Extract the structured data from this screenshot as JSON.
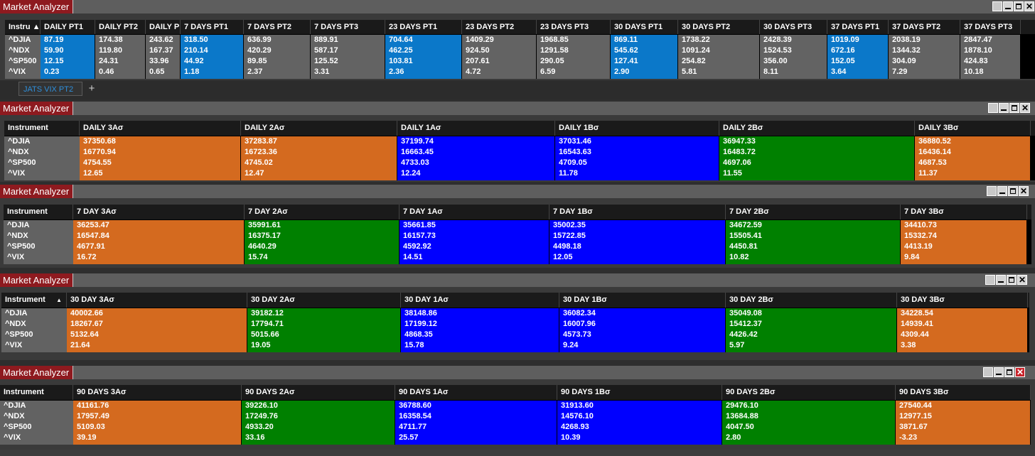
{
  "instruments": [
    "^DJIA",
    "^NDX",
    "^SP500",
    "^VIX"
  ],
  "panel1": {
    "title": "Market Analyzer",
    "label_header": "Instru ▲",
    "columns": [
      {
        "h": "DAILY PT1",
        "v": [
          "87.19",
          "59.90",
          "12.15",
          "0.23"
        ]
      },
      {
        "h": "DAILY PT2",
        "v": [
          "174.38",
          "119.80",
          "24.31",
          "0.46"
        ]
      },
      {
        "h": "DAILY P",
        "v": [
          "243.62",
          "167.37",
          "33.96",
          "0.65"
        ]
      },
      {
        "h": "7 DAYS PT1",
        "v": [
          "318.50",
          "210.14",
          "44.92",
          "1.18"
        ]
      },
      {
        "h": "7 DAYS PT2",
        "v": [
          "636.99",
          "420.29",
          "89.85",
          "2.37"
        ]
      },
      {
        "h": "7 DAYS PT3",
        "v": [
          "889.91",
          "587.17",
          "125.52",
          "3.31"
        ]
      },
      {
        "h": "23 DAYS PT1",
        "v": [
          "704.64",
          "462.25",
          "103.81",
          "2.36"
        ]
      },
      {
        "h": "23 DAYS PT2",
        "v": [
          "1409.29",
          "924.50",
          "207.61",
          "4.72"
        ]
      },
      {
        "h": "23 DAYS PT3",
        "v": [
          "1968.85",
          "1291.58",
          "290.05",
          "6.59"
        ]
      },
      {
        "h": "30 DAYS PT1",
        "v": [
          "869.11",
          "545.62",
          "127.41",
          "2.90"
        ]
      },
      {
        "h": "30 DAYS PT2",
        "v": [
          "1738.22",
          "1091.24",
          "254.82",
          "5.81"
        ]
      },
      {
        "h": "30 DAYS PT3",
        "v": [
          "2428.39",
          "1524.53",
          "356.00",
          "8.11"
        ]
      },
      {
        "h": "37 DAYS PT1",
        "v": [
          "1019.09",
          "672.16",
          "152.05",
          "3.64"
        ]
      },
      {
        "h": "37 DAYS PT2",
        "v": [
          "2038.19",
          "1344.32",
          "304.09",
          "7.29"
        ]
      },
      {
        "h": "37 DAYS PT3",
        "v": [
          "2847.47",
          "1878.10",
          "424.83",
          "10.18"
        ]
      }
    ],
    "tab": "JATS VIX PT2",
    "add_tab": "+"
  },
  "panel2": {
    "title": "Market Analyzer",
    "label_header": "Instrument",
    "columns": [
      {
        "h": "DAILY 3Aσ",
        "v": [
          "37350.68",
          "16770.94",
          "4754.55",
          "12.65"
        ]
      },
      {
        "h": "DAILY 2Aσ",
        "v": [
          "37283.87",
          "16723.36",
          "4745.02",
          "12.47"
        ]
      },
      {
        "h": "DAILY 1Aσ",
        "v": [
          "37199.74",
          "16663.45",
          "4733.03",
          "12.24"
        ]
      },
      {
        "h": "DAILY 1Bσ",
        "v": [
          "37031.46",
          "16543.63",
          "4709.05",
          "11.78"
        ]
      },
      {
        "h": "DAILY 2Bσ",
        "v": [
          "36947.33",
          "16483.72",
          "4697.06",
          "11.55"
        ]
      },
      {
        "h": "DAILY 3Bσ",
        "v": [
          "36880.52",
          "16436.14",
          "4687.53",
          "11.37"
        ]
      }
    ]
  },
  "panel3": {
    "title": "Market Analyzer",
    "label_header": "Instrument",
    "columns": [
      {
        "h": "7 DAY 3Aσ",
        "v": [
          "36253.47",
          "16547.84",
          "4677.91",
          "16.72"
        ]
      },
      {
        "h": "7 DAY 2Aσ",
        "v": [
          "35991.61",
          "16375.17",
          "4640.29",
          "15.74"
        ]
      },
      {
        "h": "7 DAY 1Aσ",
        "v": [
          "35661.85",
          "16157.73",
          "4592.92",
          "14.51"
        ]
      },
      {
        "h": "7 DAY 1Bσ",
        "v": [
          "35002.35",
          "15722.85",
          "4498.18",
          "12.05"
        ]
      },
      {
        "h": "7 DAY 2Bσ",
        "v": [
          "34672.59",
          "15505.41",
          "4450.81",
          "10.82"
        ]
      },
      {
        "h": "7 DAY 3Bσ",
        "v": [
          "34410.73",
          "15332.74",
          "4413.19",
          "9.84"
        ]
      }
    ]
  },
  "panel4": {
    "title": "Market Analyzer",
    "label_header": "Instrument",
    "sort_arrow": "▲",
    "columns": [
      {
        "h": "30 DAY 3Aσ",
        "v": [
          "40002.66",
          "18267.67",
          "5132.64",
          "21.64"
        ]
      },
      {
        "h": "30 DAY 2Aσ",
        "v": [
          "39182.12",
          "17794.71",
          "5015.66",
          "19.05"
        ]
      },
      {
        "h": "30 DAY 1Aσ",
        "v": [
          "38148.86",
          "17199.12",
          "4868.35",
          "15.78"
        ]
      },
      {
        "h": "30 DAY 1Bσ",
        "v": [
          "36082.34",
          "16007.96",
          "4573.73",
          "9.24"
        ]
      },
      {
        "h": "30 DAY 2Bσ",
        "v": [
          "35049.08",
          "15412.37",
          "4426.42",
          "5.97"
        ]
      },
      {
        "h": "30 DAY 3Bσ",
        "v": [
          "34228.54",
          "14939.41",
          "4309.44",
          "3.38"
        ]
      }
    ]
  },
  "panel5": {
    "title": "Market Analyzer",
    "label_header": "Instrument",
    "columns": [
      {
        "h": "90 DAYS 3Aσ",
        "v": [
          "41161.76",
          "17957.49",
          "5109.03",
          "39.19"
        ]
      },
      {
        "h": "90 DAYS 2Aσ",
        "v": [
          "39226.10",
          "17249.76",
          "4933.20",
          "33.16"
        ]
      },
      {
        "h": "90 DAYS 1Aσ",
        "v": [
          "36788.60",
          "16358.54",
          "4711.77",
          "25.57"
        ]
      },
      {
        "h": "90 DAYS 1Bσ",
        "v": [
          "31913.60",
          "14576.10",
          "4268.93",
          "10.39"
        ]
      },
      {
        "h": "90 DAYS 2Bσ",
        "v": [
          "29476.10",
          "13684.88",
          "4047.50",
          "2.80"
        ]
      },
      {
        "h": "90 DAYS 3Bσ",
        "v": [
          "27540.44",
          "12977.15",
          "3871.67",
          "-3.23"
        ]
      }
    ]
  },
  "colors": {
    "orange": "#d46a1f",
    "green": "#008000",
    "blue": "#0000ff",
    "sky": "#0b78c9",
    "gray": "#636363",
    "title_red": "#8e1a1f"
  },
  "window_controls": {
    "minimize": "minimize-icon",
    "maximize": "maximize-icon",
    "close": "✕"
  }
}
